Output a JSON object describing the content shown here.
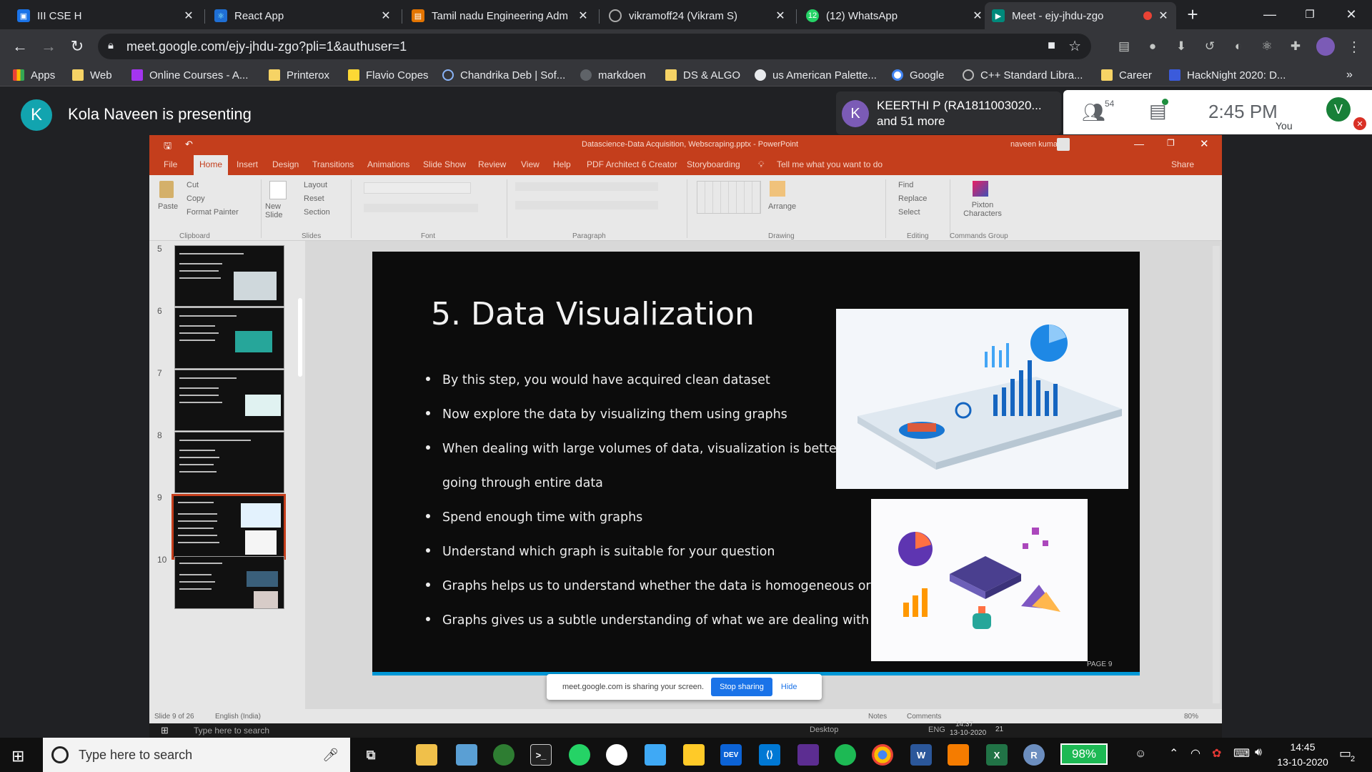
{
  "browser": {
    "tabs": [
      {
        "title": "III CSE H",
        "icon": "google-classroom-icon",
        "color": "#1a73e8"
      },
      {
        "title": "React App",
        "icon": "react-icon",
        "color": "#61dafb"
      },
      {
        "title": "Tamil nadu Engineering Adm",
        "icon": "document-icon",
        "color": "#e37400"
      },
      {
        "title": "vikramoff24 (Vikram S)",
        "icon": "github-icon",
        "color": "#ffffff"
      },
      {
        "title": "(12) WhatsApp",
        "icon": "whatsapp-icon",
        "color": "#25d366"
      },
      {
        "title": "Meet - ejy-jhdu-zgo",
        "icon": "meet-icon",
        "color": "#00897b"
      }
    ],
    "url": "meet.google.com/ejy-jhdu-zgo?pli=1&authuser=1",
    "bookmarks": [
      "Apps",
      "Web",
      "Online Courses - A...",
      "Printerox",
      "Flavio Copes",
      "Chandrika Deb | Sof...",
      "markdoen",
      "DS & ALGO",
      "us American Palette...",
      "Google",
      "C++ Standard Libra...",
      "Career",
      "HackNight 2020: D..."
    ]
  },
  "meet": {
    "presenter_initial": "K",
    "presenter_text": "Kola Naveen is presenting",
    "participant_initial": "K",
    "participant_name": "KEERTHI P (RA1811003020...",
    "participant_more": "and 51 more",
    "people_count": "54",
    "time": "2:45 PM",
    "you_initial": "V",
    "you_label": "You"
  },
  "powerpoint": {
    "window_title": "Datascience-Data Acquisition, Webscraping.pptx - PowerPoint",
    "user": "naveen kumar",
    "tabs": [
      "File",
      "Home",
      "Insert",
      "Design",
      "Transitions",
      "Animations",
      "Slide Show",
      "Review",
      "View",
      "Help",
      "PDF Architect 6 Creator",
      "Storyboarding"
    ],
    "tell_me": "Tell me what you want to do",
    "share": "Share",
    "ribbon": {
      "paste": "Paste",
      "cut": "Cut",
      "copy": "Copy",
      "format_painter": "Format Painter",
      "new_slide": "New Slide",
      "layout": "Layout",
      "reset": "Reset",
      "section": "Section",
      "arrange": "Arrange",
      "find": "Find",
      "replace": "Replace",
      "select": "Select",
      "pixton": "Pixton Characters",
      "groups": [
        "Clipboard",
        "Slides",
        "Font",
        "Paragraph",
        "Drawing",
        "Editing",
        "Commands Group"
      ]
    },
    "thumbnails": [
      {
        "num": "5",
        "title": "1. Understand the Problem – Frame the Question"
      },
      {
        "num": "6",
        "title": "2. Get your Data – Data Acquisition"
      },
      {
        "num": "7",
        "title": "3. Is your Data Clean – Data Cleaning"
      },
      {
        "num": "8",
        "title": "4. Explore the Data – Make data Qualitative"
      },
      {
        "num": "9",
        "title": "5. Data Visualization"
      },
      {
        "num": "10",
        "title": "6. Knowledge Extraction"
      }
    ],
    "slide": {
      "title": "5. Data Visualization",
      "bullets": [
        "By this step, you would have acquired clean dataset",
        "Now explore the data by visualizing them using graphs",
        "When dealing with large volumes of data, visualization is better that",
        "Spend enough time with graphs",
        "Understand which graph is suitable for your question",
        "Graphs helps us to understand whether the data is homogeneous or not",
        "Graphs gives us a subtle understanding of what we are dealing with"
      ],
      "continuation": "going through entire data",
      "page": "PAGE 9"
    },
    "status": {
      "slide": "Slide 9 of 26",
      "lang": "English (India)",
      "notes": "Notes",
      "comments": "Comments",
      "zoom": "80%"
    },
    "share_notice": "meet.google.com is sharing your screen.",
    "stop_sharing": "Stop sharing",
    "hide": "Hide",
    "inner_search": "Type here to search",
    "inner_desktop": "Desktop",
    "inner_lang": "ENG",
    "inner_time": "14:37",
    "inner_date": "13-10-2020",
    "inner_notif": "21"
  },
  "taskbar": {
    "search": "Type here to search",
    "battery": "98%",
    "time": "14:45",
    "date": "13-10-2020",
    "notifications": "2"
  }
}
